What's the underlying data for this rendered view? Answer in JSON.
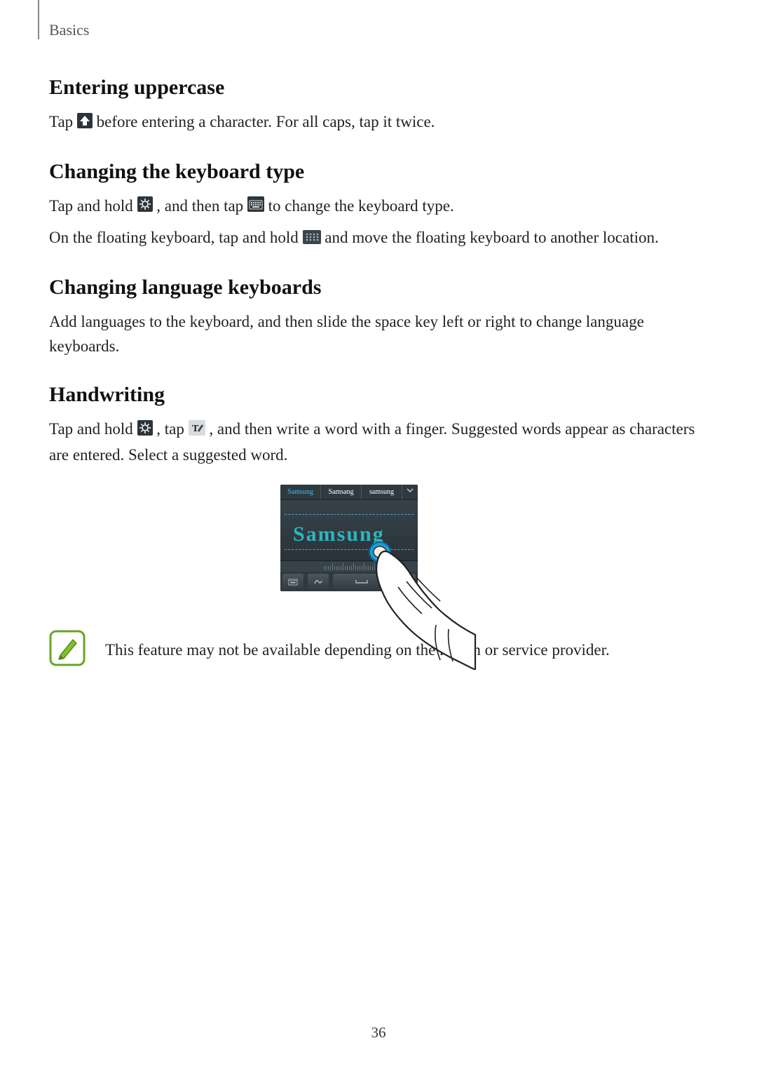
{
  "header": {
    "section": "Basics"
  },
  "sections": {
    "s1": {
      "heading": "Entering uppercase",
      "p1a": "Tap ",
      "p1b": " before entering a character. For all caps, tap it twice."
    },
    "s2": {
      "heading": "Changing the keyboard type",
      "p1a": "Tap and hold ",
      "p1b": ", and then tap ",
      "p1c": " to change the keyboard type.",
      "p2a": "On the floating keyboard, tap and hold ",
      "p2b": " and move the floating keyboard to another location."
    },
    "s3": {
      "heading": "Changing language keyboards",
      "p1": "Add languages to the keyboard, and then slide the space key left or right to change language keyboards."
    },
    "s4": {
      "heading": "Handwriting",
      "p1a": "Tap and hold ",
      "p1b": ", tap ",
      "p1c": ", and then write a word with a finger. Suggested words appear as characters are entered. Select a suggested word."
    }
  },
  "figure": {
    "suggestions": {
      "s1": "Samsung",
      "s2": "Samsang",
      "s3": "samsung"
    },
    "handwritten": "Samsung"
  },
  "note": {
    "text": "This feature may not be available depending on the region or service provider."
  },
  "pageNumber": "36",
  "icons": {
    "shift": "shift-icon",
    "settings": "settings-gear-icon",
    "keyboard": "keyboard-layout-icon",
    "grip": "drag-handle-icon",
    "handwriting": "t-pen-icon",
    "note": "notepad-pen-icon"
  }
}
